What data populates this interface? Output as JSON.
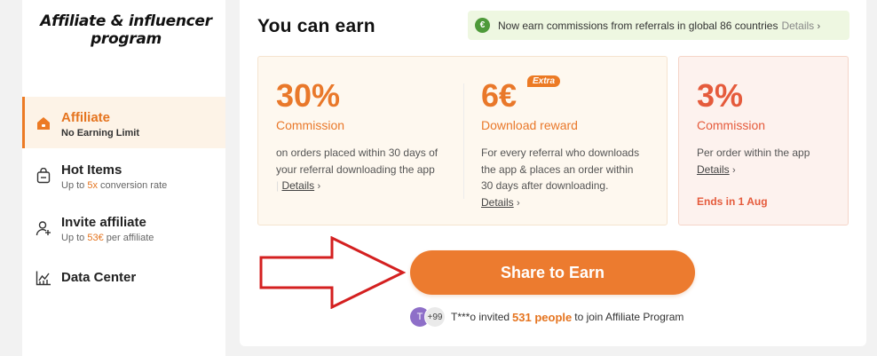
{
  "sidebar": {
    "logo": "Affiliate & influencer program",
    "items": [
      {
        "title": "Affiliate",
        "sub": "No Earning Limit",
        "icon": "home-icon"
      },
      {
        "title": "Hot Items",
        "sub_pre": "Up to ",
        "sub_hl": "5x",
        "sub_post": " conversion rate",
        "icon": "shopping-bag-icon"
      },
      {
        "title": "Invite affiliate",
        "sub_pre": "Up to ",
        "sub_hl": "53€",
        "sub_post": " per affiliate",
        "icon": "add-user-icon"
      },
      {
        "title": "Data Center",
        "icon": "chart-icon"
      }
    ]
  },
  "main": {
    "heading": "You can earn",
    "banner": {
      "badge": "€",
      "text": "Now earn commissions from referrals in global 86 countries",
      "link": "Details"
    },
    "card1": {
      "value": "30%",
      "label": "Commission",
      "desc1": "on orders placed within 30 days of",
      "desc2": "your referral downloading the app",
      "link": "Details"
    },
    "card2": {
      "value": "6€",
      "tag": "Extra",
      "label": "Download reward",
      "desc1": "For every referral who downloads",
      "desc2": "the app & places an order within",
      "desc3": "30 days after downloading.",
      "link": "Details"
    },
    "card3": {
      "value": "3%",
      "label": "Commission",
      "desc1": "Per order within the app",
      "link": "Details",
      "ends": "Ends in 1 Aug"
    },
    "share_button": "Share to Earn",
    "invite": {
      "avatar_initial": "T",
      "more": "+99",
      "pre": "T***o invited",
      "count": "531 people",
      "post": "to join Affiliate Program"
    }
  },
  "colors": {
    "accent": "#ec7a24",
    "red_accent": "#e55b3c",
    "arrow": "#d42020"
  }
}
